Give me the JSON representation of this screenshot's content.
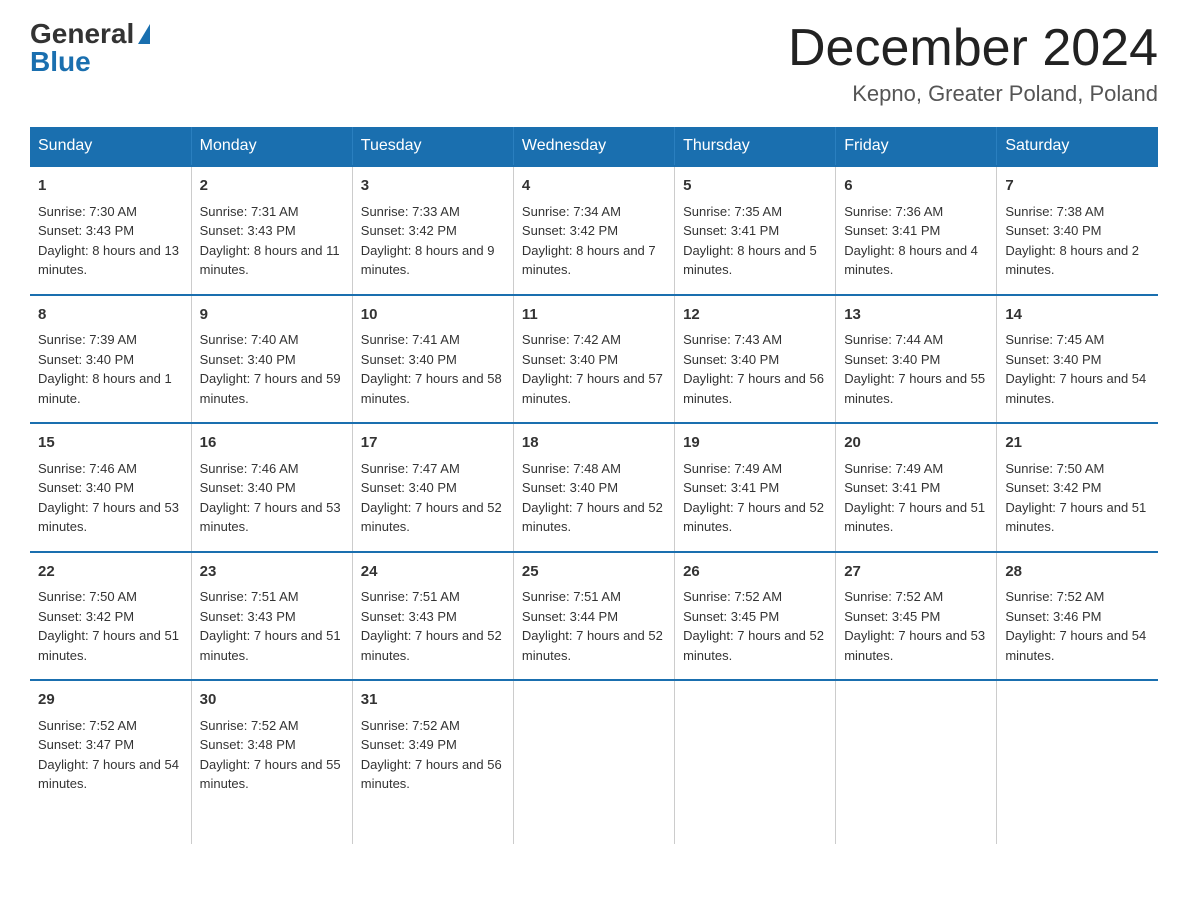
{
  "logo": {
    "general": "General",
    "blue": "Blue"
  },
  "title": "December 2024",
  "location": "Kepno, Greater Poland, Poland",
  "days_header": [
    "Sunday",
    "Monday",
    "Tuesday",
    "Wednesday",
    "Thursday",
    "Friday",
    "Saturday"
  ],
  "weeks": [
    [
      {
        "num": "1",
        "sunrise": "7:30 AM",
        "sunset": "3:43 PM",
        "daylight": "8 hours and 13 minutes."
      },
      {
        "num": "2",
        "sunrise": "7:31 AM",
        "sunset": "3:43 PM",
        "daylight": "8 hours and 11 minutes."
      },
      {
        "num": "3",
        "sunrise": "7:33 AM",
        "sunset": "3:42 PM",
        "daylight": "8 hours and 9 minutes."
      },
      {
        "num": "4",
        "sunrise": "7:34 AM",
        "sunset": "3:42 PM",
        "daylight": "8 hours and 7 minutes."
      },
      {
        "num": "5",
        "sunrise": "7:35 AM",
        "sunset": "3:41 PM",
        "daylight": "8 hours and 5 minutes."
      },
      {
        "num": "6",
        "sunrise": "7:36 AM",
        "sunset": "3:41 PM",
        "daylight": "8 hours and 4 minutes."
      },
      {
        "num": "7",
        "sunrise": "7:38 AM",
        "sunset": "3:40 PM",
        "daylight": "8 hours and 2 minutes."
      }
    ],
    [
      {
        "num": "8",
        "sunrise": "7:39 AM",
        "sunset": "3:40 PM",
        "daylight": "8 hours and 1 minute."
      },
      {
        "num": "9",
        "sunrise": "7:40 AM",
        "sunset": "3:40 PM",
        "daylight": "7 hours and 59 minutes."
      },
      {
        "num": "10",
        "sunrise": "7:41 AM",
        "sunset": "3:40 PM",
        "daylight": "7 hours and 58 minutes."
      },
      {
        "num": "11",
        "sunrise": "7:42 AM",
        "sunset": "3:40 PM",
        "daylight": "7 hours and 57 minutes."
      },
      {
        "num": "12",
        "sunrise": "7:43 AM",
        "sunset": "3:40 PM",
        "daylight": "7 hours and 56 minutes."
      },
      {
        "num": "13",
        "sunrise": "7:44 AM",
        "sunset": "3:40 PM",
        "daylight": "7 hours and 55 minutes."
      },
      {
        "num": "14",
        "sunrise": "7:45 AM",
        "sunset": "3:40 PM",
        "daylight": "7 hours and 54 minutes."
      }
    ],
    [
      {
        "num": "15",
        "sunrise": "7:46 AM",
        "sunset": "3:40 PM",
        "daylight": "7 hours and 53 minutes."
      },
      {
        "num": "16",
        "sunrise": "7:46 AM",
        "sunset": "3:40 PM",
        "daylight": "7 hours and 53 minutes."
      },
      {
        "num": "17",
        "sunrise": "7:47 AM",
        "sunset": "3:40 PM",
        "daylight": "7 hours and 52 minutes."
      },
      {
        "num": "18",
        "sunrise": "7:48 AM",
        "sunset": "3:40 PM",
        "daylight": "7 hours and 52 minutes."
      },
      {
        "num": "19",
        "sunrise": "7:49 AM",
        "sunset": "3:41 PM",
        "daylight": "7 hours and 52 minutes."
      },
      {
        "num": "20",
        "sunrise": "7:49 AM",
        "sunset": "3:41 PM",
        "daylight": "7 hours and 51 minutes."
      },
      {
        "num": "21",
        "sunrise": "7:50 AM",
        "sunset": "3:42 PM",
        "daylight": "7 hours and 51 minutes."
      }
    ],
    [
      {
        "num": "22",
        "sunrise": "7:50 AM",
        "sunset": "3:42 PM",
        "daylight": "7 hours and 51 minutes."
      },
      {
        "num": "23",
        "sunrise": "7:51 AM",
        "sunset": "3:43 PM",
        "daylight": "7 hours and 51 minutes."
      },
      {
        "num": "24",
        "sunrise": "7:51 AM",
        "sunset": "3:43 PM",
        "daylight": "7 hours and 52 minutes."
      },
      {
        "num": "25",
        "sunrise": "7:51 AM",
        "sunset": "3:44 PM",
        "daylight": "7 hours and 52 minutes."
      },
      {
        "num": "26",
        "sunrise": "7:52 AM",
        "sunset": "3:45 PM",
        "daylight": "7 hours and 52 minutes."
      },
      {
        "num": "27",
        "sunrise": "7:52 AM",
        "sunset": "3:45 PM",
        "daylight": "7 hours and 53 minutes."
      },
      {
        "num": "28",
        "sunrise": "7:52 AM",
        "sunset": "3:46 PM",
        "daylight": "7 hours and 54 minutes."
      }
    ],
    [
      {
        "num": "29",
        "sunrise": "7:52 AM",
        "sunset": "3:47 PM",
        "daylight": "7 hours and 54 minutes."
      },
      {
        "num": "30",
        "sunrise": "7:52 AM",
        "sunset": "3:48 PM",
        "daylight": "7 hours and 55 minutes."
      },
      {
        "num": "31",
        "sunrise": "7:52 AM",
        "sunset": "3:49 PM",
        "daylight": "7 hours and 56 minutes."
      },
      null,
      null,
      null,
      null
    ]
  ]
}
